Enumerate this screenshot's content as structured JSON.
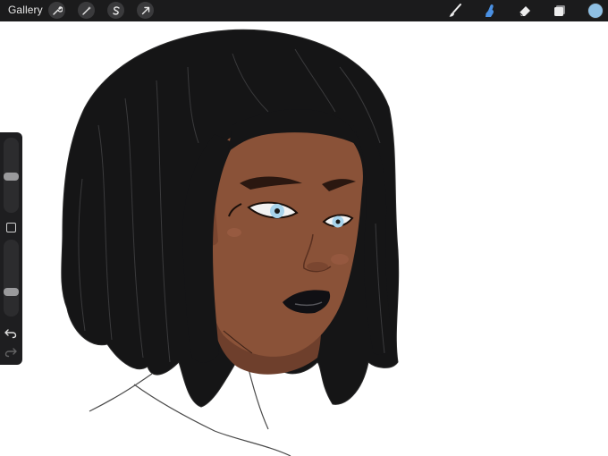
{
  "toolbar": {
    "gallery_label": "Gallery",
    "left_tools": [
      {
        "name": "actions",
        "icon": "wrench-icon"
      },
      {
        "name": "adjustments",
        "icon": "magic-wand-icon"
      },
      {
        "name": "selection",
        "icon": "selection-s-icon"
      },
      {
        "name": "transform",
        "icon": "transform-arrow-icon"
      }
    ],
    "right_tools": [
      {
        "name": "brush",
        "icon": "brush-icon",
        "active": false
      },
      {
        "name": "smudge",
        "icon": "smudge-finger-icon",
        "active": true
      },
      {
        "name": "eraser",
        "icon": "eraser-icon",
        "active": false
      },
      {
        "name": "layers",
        "icon": "layers-icon",
        "active": false
      }
    ],
    "active_color": "#8fc0e4",
    "accent_color": "#4a90e2"
  },
  "sidebar": {
    "brush_size_level": 0.48,
    "opacity_level": 0.3,
    "undo_icon": "undo-icon",
    "redo_icon": "redo-icon"
  },
  "artwork": {
    "hair_color": "#151516",
    "skin_color": "#8a5238",
    "skin_shadow": "#6e3f2c",
    "eye_color": "#a8d4ec",
    "lip_color": "#101014"
  }
}
